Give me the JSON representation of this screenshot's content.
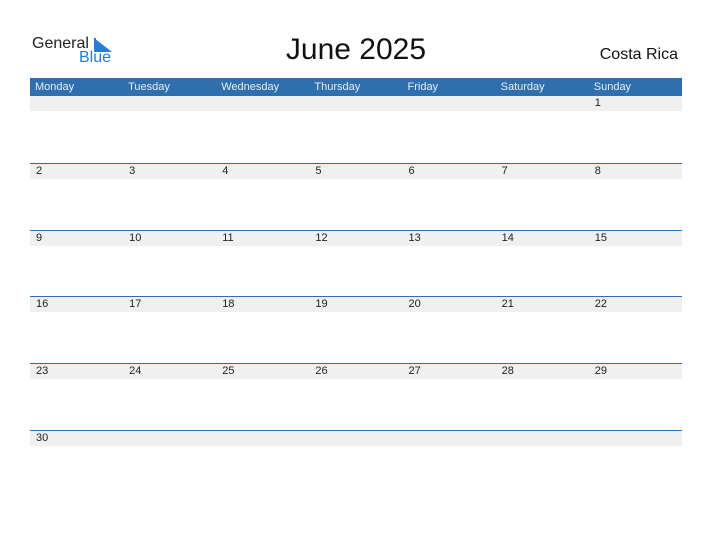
{
  "logo": {
    "general": "General",
    "blue": "Blue"
  },
  "title": "June 2025",
  "country": "Costa Rica",
  "weekdays": [
    "Monday",
    "Tuesday",
    "Wednesday",
    "Thursday",
    "Friday",
    "Saturday",
    "Sunday"
  ],
  "weeks": [
    [
      "",
      "",
      "",
      "",
      "",
      "",
      "1"
    ],
    [
      "2",
      "3",
      "4",
      "5",
      "6",
      "7",
      "8"
    ],
    [
      "9",
      "10",
      "11",
      "12",
      "13",
      "14",
      "15"
    ],
    [
      "16",
      "17",
      "18",
      "19",
      "20",
      "21",
      "22"
    ],
    [
      "23",
      "24",
      "25",
      "26",
      "27",
      "28",
      "29"
    ],
    [
      "30",
      "",
      "",
      "",
      "",
      "",
      ""
    ]
  ],
  "colors": {
    "header": "#2f6fae",
    "band": "#f0f0f0",
    "brand_blue": "#2a7bd4"
  }
}
